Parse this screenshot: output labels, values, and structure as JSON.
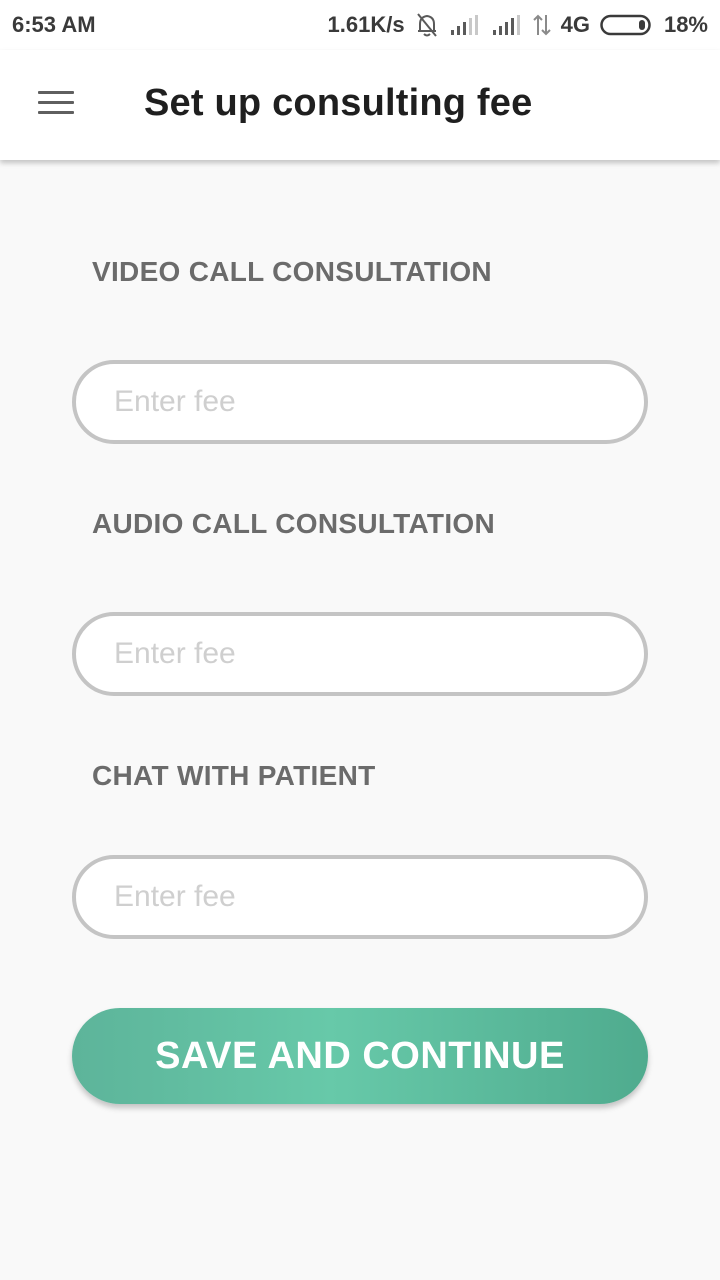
{
  "status_bar": {
    "time": "6:53 AM",
    "network_speed": "1.61K/s",
    "network_type": "4G",
    "battery": "18%",
    "icons": [
      "bell-off-icon",
      "signal-icon",
      "signal-icon",
      "data-arrows-icon",
      "battery-icon"
    ]
  },
  "app_bar": {
    "title": "Set up consulting fee",
    "menu_icon": "menu-icon"
  },
  "form": {
    "video": {
      "label": "VIDEO CALL CONSULTATION",
      "placeholder": "Enter fee",
      "value": ""
    },
    "audio": {
      "label": "AUDIO CALL CONSULTATION",
      "placeholder": "Enter fee",
      "value": ""
    },
    "chat": {
      "label": "CHAT WITH PATIENT",
      "placeholder": "Enter fee",
      "value": ""
    },
    "save_label": "SAVE AND CONTINUE"
  },
  "colors": {
    "accent": "#63c1a3",
    "background": "#f9f9f9",
    "label": "#6b6b6b",
    "input_border": "#c4c4c4"
  }
}
